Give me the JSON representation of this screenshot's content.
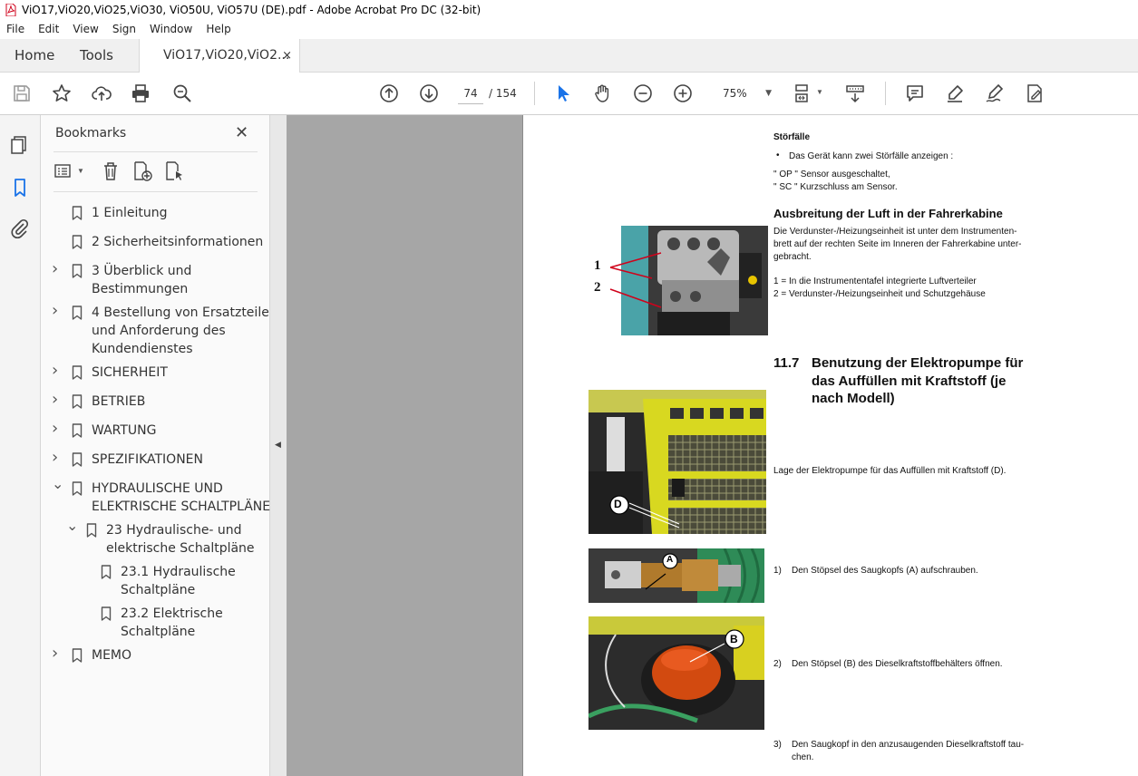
{
  "window": {
    "title": "ViO17,ViO20,ViO25,ViO30, ViO50U, ViO57U (DE).pdf - Adobe Acrobat Pro DC (32-bit)"
  },
  "menu": [
    "File",
    "Edit",
    "View",
    "Sign",
    "Window",
    "Help"
  ],
  "tabs": {
    "home": "Home",
    "tools": "Tools",
    "document": "ViO17,ViO20,ViO2...",
    "close": "×"
  },
  "toolbar": {
    "page_current": "74",
    "page_total": "/ 154",
    "zoom": "75%"
  },
  "bookmarks": {
    "title": "Bookmarks",
    "close": "✕",
    "items": [
      {
        "label": "1 Einleitung",
        "expand": ""
      },
      {
        "label": "2 Sicherheitsinformationen",
        "expand": ""
      },
      {
        "label": "3 Überblick und\nBestimmungen",
        "expand": "right"
      },
      {
        "label": "4 Bestellung von Ersatzteilen\nund Anforderung des\nKundendienstes",
        "expand": "right"
      },
      {
        "label": "SICHERHEIT",
        "expand": "right"
      },
      {
        "label": "BETRIEB",
        "expand": "right"
      },
      {
        "label": "WARTUNG",
        "expand": "right"
      },
      {
        "label": "SPEZIFIKATIONEN",
        "expand": "right"
      },
      {
        "label": "HYDRAULISCHE UND\nELEKTRISCHE SCHALTPLÄNE",
        "expand": "down"
      },
      {
        "label": "23 Hydraulische- und\nelektrische Schaltpläne",
        "expand": "down"
      },
      {
        "label": "23.1 Hydraulische\nSchaltpläne",
        "expand": ""
      },
      {
        "label": "23.2 Elektrische\nSchaltpläne",
        "expand": ""
      },
      {
        "label": "MEMO",
        "expand": "right"
      }
    ]
  },
  "pdf": {
    "stoerfaelle_title": "Störfälle",
    "stoerfaelle_bullet": "Das Gerät kann zwei Störfälle anzeigen :",
    "op_line": "\" OP \" Sensor ausgeschaltet,",
    "sc_line": "\" SC \" Kurzschluss am Sensor.",
    "air_title": "Ausbreitung der Luft in der Fahrerkabine",
    "air_body_1": "Die Verdunster-/Heizungseinheit ist unter dem Instrumenten-",
    "air_body_2": "brett auf der rechten Seite im Inneren der Fahrerkabine unter-",
    "air_body_3": "gebracht.",
    "air_item_1": "1 = In die Instrumententafel integrierte Luftverteiler",
    "air_item_2": "2 = Verdunster-/Heizungseinheit und Schutzgehäuse",
    "callout_1": "1",
    "callout_2": "2",
    "section_number": "11.7",
    "section_title_1": "Benutzung der Elektropumpe für",
    "section_title_2": "das Auffüllen mit Kraftstoff (je",
    "section_title_3": "nach Modell)",
    "pump_location": "Lage der Elektropumpe für das Auffüllen mit Kraftstoff (D).",
    "label_d": "D",
    "label_a": "A",
    "label_b": "B",
    "step_1_num": "1)",
    "step_1": "Den Stöpsel des Saugkopfs (A) aufschrauben.",
    "step_2_num": "2)",
    "step_2": "Den Stöpsel (B) des Dieselkraftstoffbehälters öffnen.",
    "step_3_num": "3)",
    "step_3a": "Den Saugkopf in den anzusaugenden Dieselkraftstoff tau-",
    "step_3b": "chen."
  }
}
